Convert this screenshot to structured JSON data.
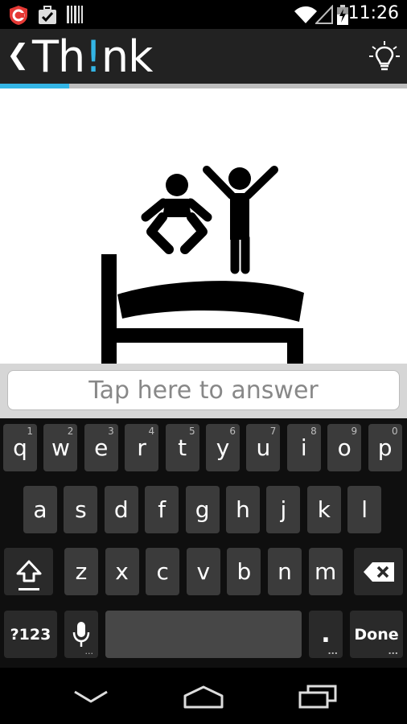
{
  "status_bar": {
    "time": "11:26",
    "left_icons": [
      "shield-app-icon",
      "briefcase-check-icon",
      "barcode-icon"
    ],
    "right_icons": [
      "wifi-icon",
      "signal-icon",
      "battery-charging-icon"
    ]
  },
  "app_bar": {
    "back_icon": "chevron-left-icon",
    "title_part1": "Th",
    "title_accent": "!",
    "title_part2": "nk",
    "hint_icon": "lightbulb-icon",
    "accent_color": "#33b5e5",
    "progress_fraction": 0.17
  },
  "puzzle": {
    "image_icon": "jumping-on-bed-pictogram"
  },
  "answer": {
    "placeholder": "Tap here to answer"
  },
  "keyboard": {
    "row1": [
      {
        "label": "q",
        "hint": "1"
      },
      {
        "label": "w",
        "hint": "2"
      },
      {
        "label": "e",
        "hint": "3"
      },
      {
        "label": "r",
        "hint": "4"
      },
      {
        "label": "t",
        "hint": "5"
      },
      {
        "label": "y",
        "hint": "6"
      },
      {
        "label": "u",
        "hint": "7"
      },
      {
        "label": "i",
        "hint": "8"
      },
      {
        "label": "o",
        "hint": "9"
      },
      {
        "label": "p",
        "hint": "0"
      }
    ],
    "row2": [
      "a",
      "s",
      "d",
      "f",
      "g",
      "h",
      "j",
      "k",
      "l"
    ],
    "row3": [
      "z",
      "x",
      "c",
      "v",
      "b",
      "n",
      "m"
    ],
    "shift_icon": "shift-icon",
    "delete_icon": "backspace-icon",
    "symbols_label": "?123",
    "mic_icon": "microphone-icon",
    "period_label": ".",
    "done_label": "Done",
    "more_dots": "..."
  },
  "nav_bar": {
    "icons": [
      "hide-keyboard-icon",
      "home-icon",
      "recent-apps-icon"
    ]
  }
}
